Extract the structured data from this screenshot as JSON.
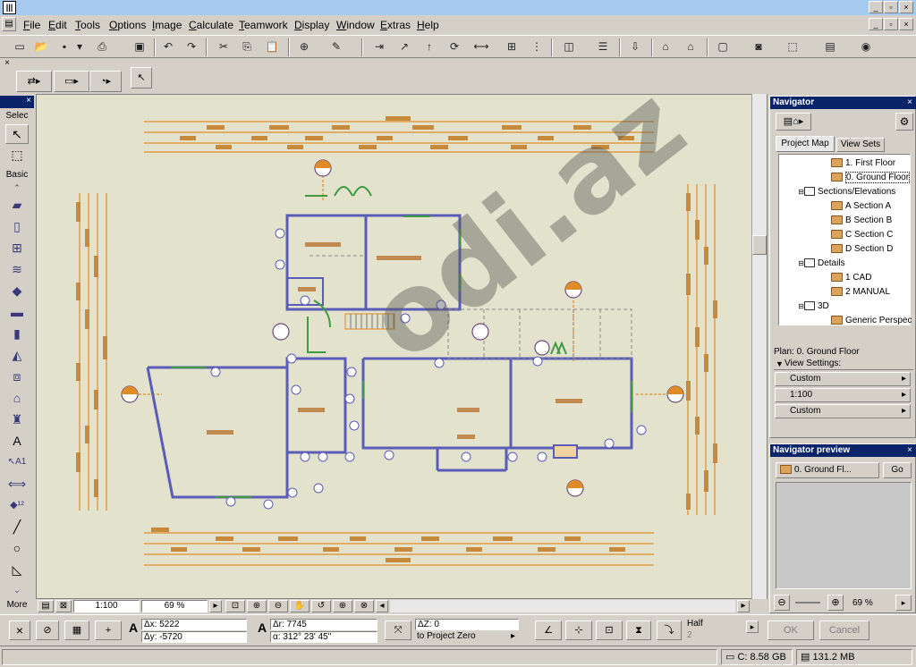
{
  "menu": [
    "File",
    "Edit",
    "Tools",
    "Options",
    "Image",
    "Calculate",
    "Teamwork",
    "Display",
    "Window",
    "Extras",
    "Help"
  ],
  "toolbox": {
    "select_label": "Selec",
    "basic_label": "Basic",
    "more_label": "More"
  },
  "navigator": {
    "title": "Navigator",
    "tabs": [
      "Project Map",
      "View Sets"
    ],
    "tree": [
      {
        "label": "1. First Floor",
        "indent": 54
      },
      {
        "label": "0. Ground Floor",
        "indent": 54
      },
      {
        "label": "Sections/Elevations",
        "indent": 30
      },
      {
        "label": "A Section A",
        "indent": 54
      },
      {
        "label": "B Section B",
        "indent": 54
      },
      {
        "label": "C Section C",
        "indent": 54
      },
      {
        "label": "D Section D",
        "indent": 54
      },
      {
        "label": "Details",
        "indent": 30
      },
      {
        "label": "1 CAD",
        "indent": 54
      },
      {
        "label": "2 MANUAL",
        "indent": 54
      },
      {
        "label": "3D",
        "indent": 30
      },
      {
        "label": "Generic Perspective",
        "indent": 54
      }
    ],
    "plan_label": "Plan: 0. Ground Floor",
    "view_settings": "View Settings:",
    "settings": [
      "Custom",
      "1:100",
      "Custom"
    ]
  },
  "preview": {
    "title": "Navigator preview",
    "selected": "0. Ground Fl...",
    "go_label": "Go",
    "zoom": "69 %"
  },
  "canvas_bar": {
    "scale": "1:100",
    "zoom": "69 %"
  },
  "infobox": {
    "dx": "Δx: 5222",
    "dy": "Δy: -5720",
    "dr": "Δr: 7745",
    "da": "α: 312° 23' 45\"",
    "dz": "ΔZ: 0",
    "to_project_zero": "to Project Zero",
    "half_label": "Half",
    "half_value": "2",
    "ok_label": "OK",
    "cancel_label": "Cancel"
  },
  "status": {
    "disk": "C: 8.58 GB",
    "memory": "131.2 MB"
  },
  "watermark": "odi.az",
  "colors": {
    "canvas_bg": "#e3e3cd",
    "wall": "#5b5bb8",
    "dimension": "#e08a28",
    "window": "#3f9a3f",
    "panel_title": "#0a246a"
  }
}
